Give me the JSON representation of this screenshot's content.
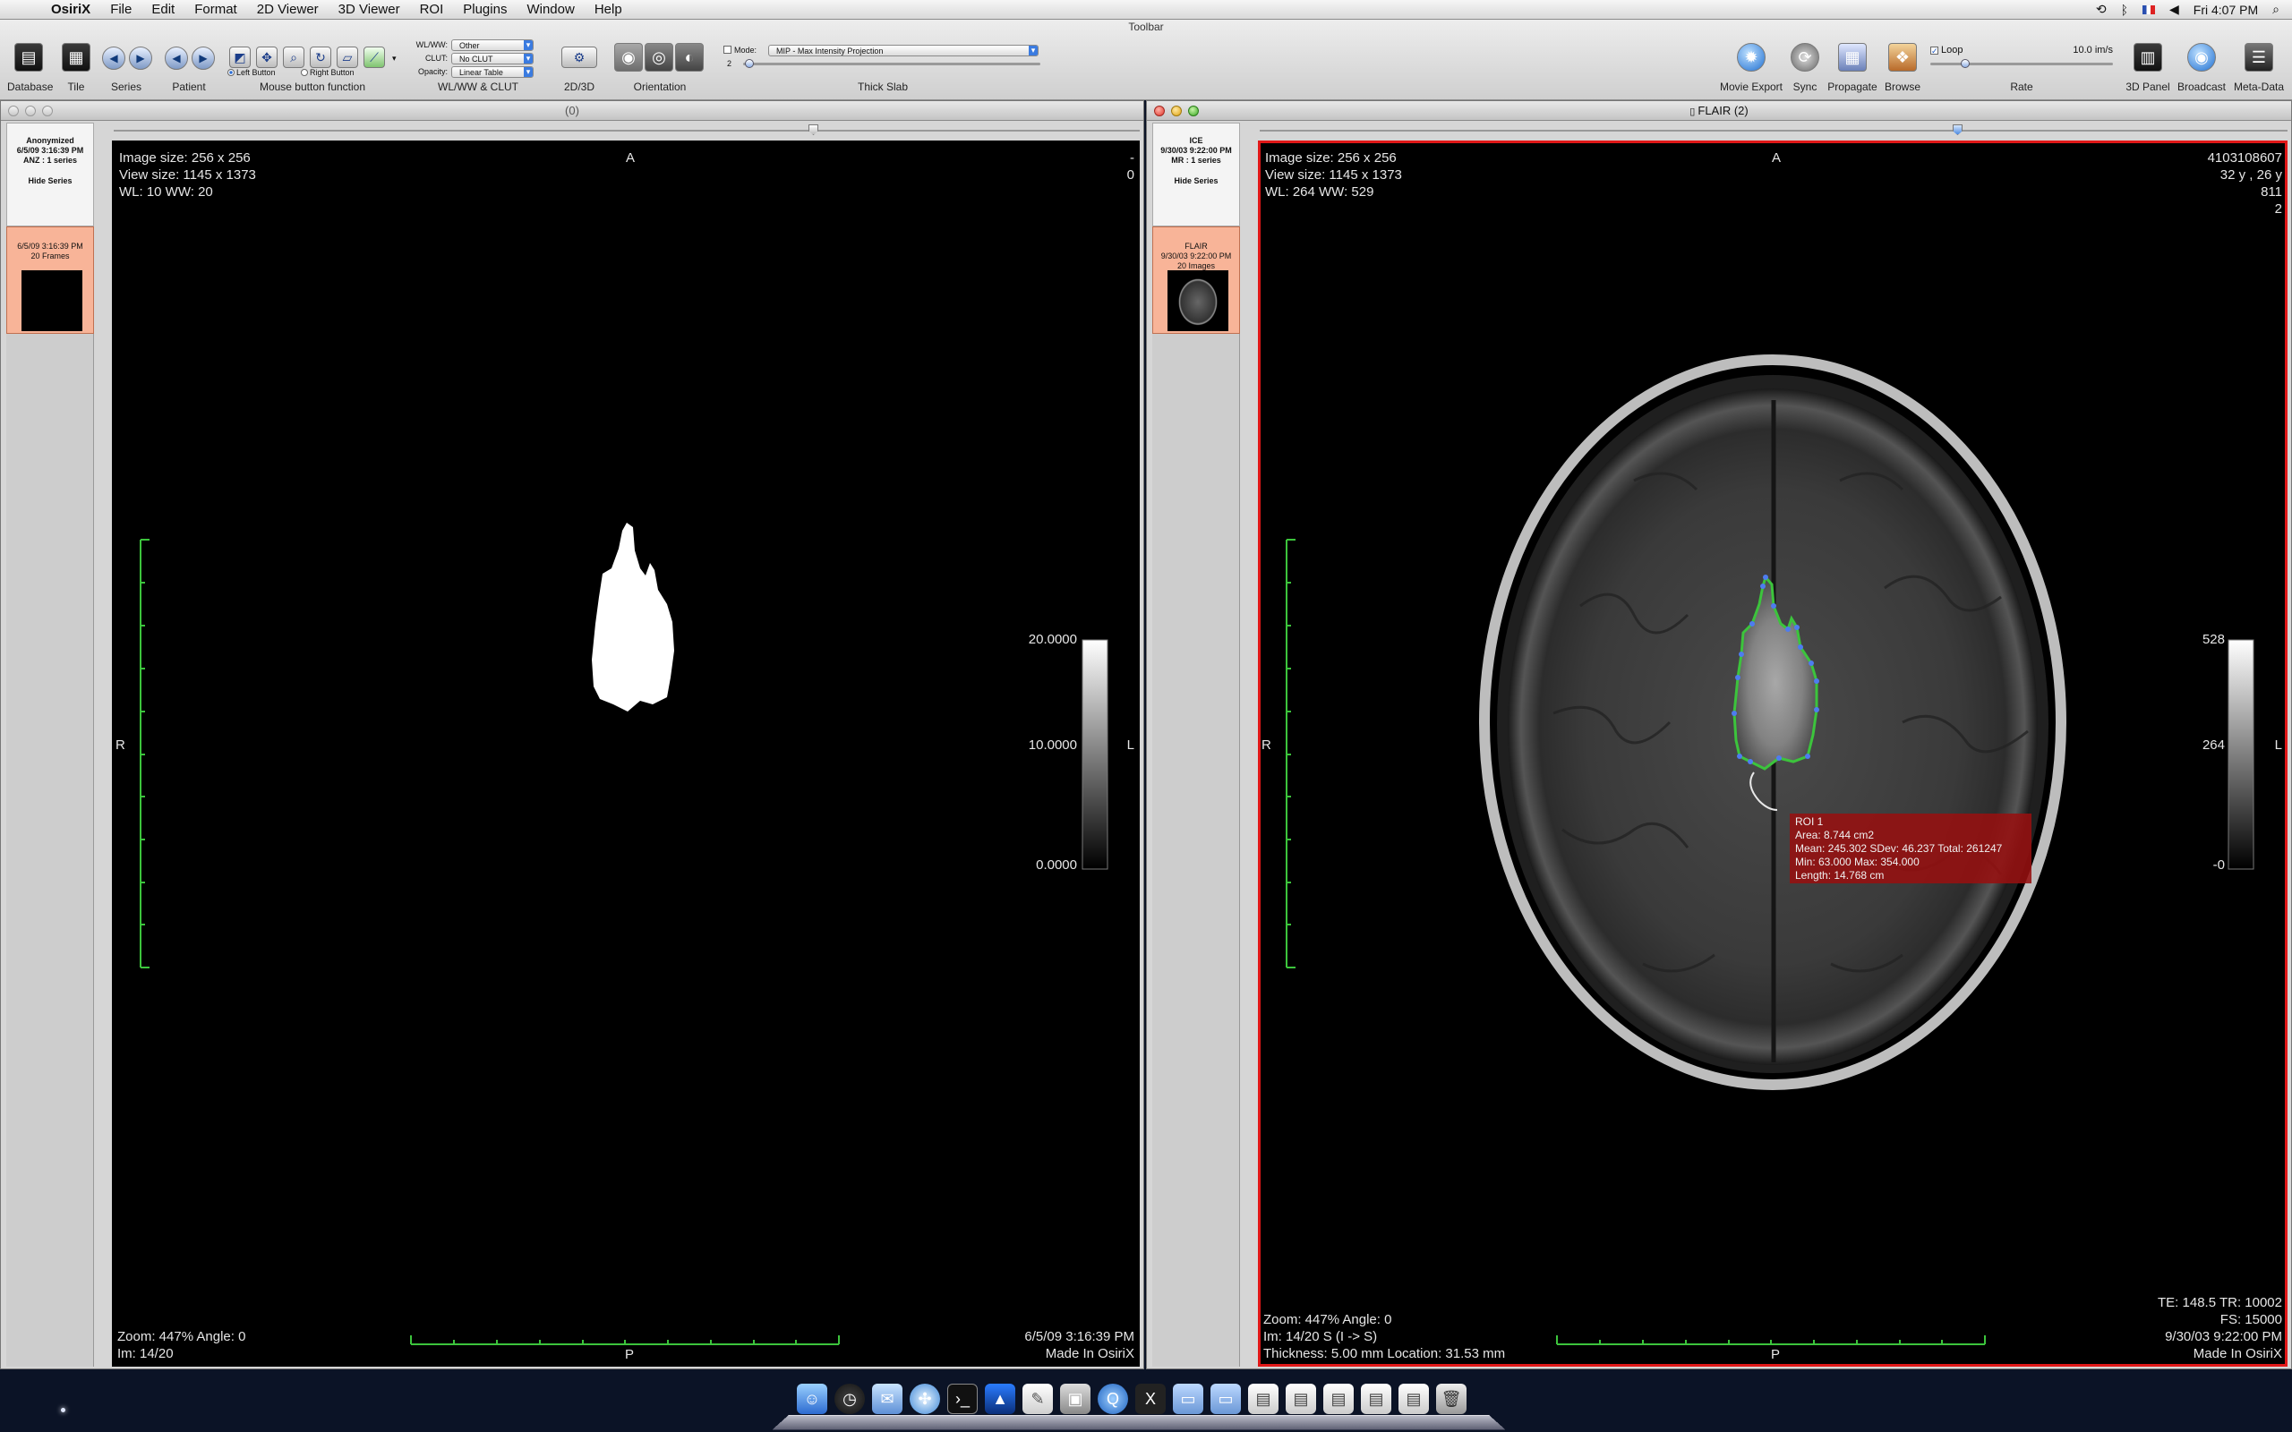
{
  "menubar": {
    "app_name": "OsiriX",
    "items": [
      "File",
      "Edit",
      "Format",
      "2D Viewer",
      "3D Viewer",
      "ROI",
      "Plugins",
      "Window",
      "Help"
    ],
    "clock": "Fri 4:07 PM"
  },
  "toolbar": {
    "title": "Toolbar",
    "labels": {
      "database": "Database",
      "tile": "Tile",
      "series": "Series",
      "patient": "Patient",
      "mouse_button_function": "Mouse button function",
      "wlww_clut": "WL/WW & CLUT",
      "twod_threed": "2D/3D",
      "orientation": "Orientation",
      "thick_slab": "Thick Slab",
      "movie_export": "Movie Export",
      "sync": "Sync",
      "propagate": "Propagate",
      "browse": "Browse",
      "rate": "Rate",
      "panel_3d": "3D Panel",
      "broadcast": "Broadcast",
      "meta_data": "Meta-Data"
    },
    "mouse": {
      "left_button": "Left Button",
      "right_button": "Right Button"
    },
    "wlww": {
      "wlww_label": "WL/WW:",
      "wlww_value": "Other",
      "clut_label": "CLUT:",
      "clut_value": "No CLUT",
      "opacity_label": "Opacity:",
      "opacity_value": "Linear Table"
    },
    "thick_slab": {
      "mode_label": "Mode:",
      "mode_value": "MIP - Max Intensity Projection",
      "count": "2"
    },
    "loop_label": "Loop",
    "rate_value": "10.0 im/s"
  },
  "left_window": {
    "title": "(0)",
    "series_header": {
      "name": "Anonymized",
      "date": "6/5/09 3:16:39 PM",
      "info": "ANZ : 1 series",
      "hide": "Hide Series"
    },
    "thumb": {
      "date": "6/5/09 3:16:39 PM",
      "count": "20 Frames"
    },
    "viewer": {
      "image_size": "Image size: 256 x 256",
      "view_size": "View size: 1145 x 1373",
      "wlww": "WL: 10 WW: 20",
      "orient_top": "A",
      "orient_left": "R",
      "orient_right": "L",
      "orient_bottom": "P",
      "top_right": "-",
      "top_right_2": "0",
      "scale_top": "20.0000",
      "scale_mid": "10.0000",
      "scale_bottom": "0.0000",
      "zoom": "Zoom: 447% Angle: 0",
      "im": "Im: 14/20",
      "date": "6/5/09 3:16:39 PM",
      "made_in": "Made In OsiriX"
    }
  },
  "right_window": {
    "title": "FLAIR (2)",
    "series_header": {
      "name": "ICE",
      "date": "9/30/03 9:22:00 PM",
      "info": "MR : 1 series",
      "hide": "Hide Series"
    },
    "thumb": {
      "name": "FLAIR",
      "date": "9/30/03 9:22:00 PM",
      "count": "20 Images"
    },
    "viewer": {
      "image_size": "Image size: 256 x 256",
      "view_size": "View size: 1145 x 1373",
      "wlww": "WL: 264 WW: 529",
      "patient_id": "4103108607",
      "age": "32 y ,  26 y",
      "tr_1": "811",
      "tr_2": "2",
      "orient_top": "A",
      "orient_left": "R",
      "orient_right": "L",
      "orient_bottom": "P",
      "scale_top": "528",
      "scale_mid": "264",
      "scale_bottom": "-0",
      "zoom": "Zoom: 447% Angle: 0",
      "im": "Im: 14/20  S (I -> S)",
      "thickness": "Thickness: 5.00 mm Location: 31.53 mm",
      "te_tr": "TE:  148.5 TR:  10002",
      "fs": "FS:  15000",
      "date": "9/30/03 9:22:00 PM",
      "made_in": "Made In OsiriX",
      "roi": {
        "name": "ROI 1",
        "area": "Area: 8.744 cm2",
        "mean": "Mean: 245.302 SDev: 46.237 Total: 261247",
        "minmax": "Min: 63.000 Max: 354.000",
        "length": "Length: 14.768 cm"
      }
    }
  },
  "dock": {
    "icons": [
      "finder-icon",
      "dashboard-icon",
      "mail-icon",
      "safari-icon",
      "terminal-icon",
      "xcode-icon",
      "preview-icon",
      "itunes-icon",
      "quicktime-icon",
      "x11-icon",
      "folder-icon",
      "folder-icon",
      "stack-icon",
      "stack-icon",
      "stack-icon",
      "stack-icon",
      "stack-icon",
      "trash-icon"
    ]
  }
}
